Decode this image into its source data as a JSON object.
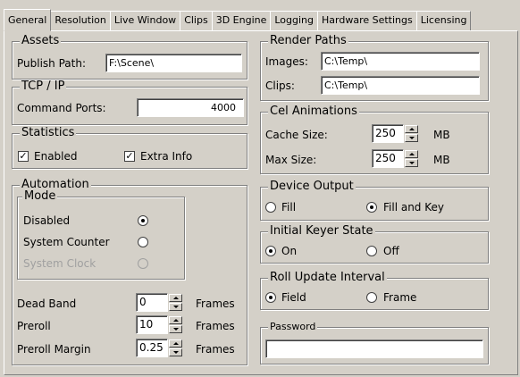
{
  "tabs": [
    "General",
    "Resolution",
    "Live Window",
    "Clips",
    "3D Engine",
    "Logging",
    "Hardware Settings",
    "Licensing"
  ],
  "assets": {
    "title": "Assets",
    "publish_label": "Publish Path:",
    "publish_value": "F:\\Scene\\"
  },
  "tcp": {
    "title": "TCP / IP",
    "ports_label": "Command Ports:",
    "ports_value": "4000"
  },
  "statistics": {
    "title": "Statistics",
    "enabled_label": "Enabled",
    "extra_label": "Extra Info",
    "enabled_checked": true,
    "extra_checked": true,
    "check_glyph": "✓"
  },
  "automation": {
    "title": "Automation",
    "mode_title": "Mode",
    "disabled_label": "Disabled",
    "system_counter_label": "System Counter",
    "system_clock_label": "System Clock",
    "selected_mode": "Disabled",
    "dead_band_label": "Dead Band",
    "dead_band_value": "0",
    "preroll_label": "Preroll",
    "preroll_value": "10",
    "preroll_margin_label": "Preroll Margin",
    "preroll_margin_value": "0.25",
    "frames_unit": "Frames"
  },
  "render_paths": {
    "title": "Render Paths",
    "images_label": "Images:",
    "images_value": "C:\\Temp\\",
    "clips_label": "Clips:",
    "clips_value": "C:\\Temp\\"
  },
  "cel_animations": {
    "title": "Cel Animations",
    "cache_label": "Cache Size:",
    "cache_value": "250",
    "max_label": "Max Size:",
    "max_value": "250",
    "unit": "MB"
  },
  "device_output": {
    "title": "Device Output",
    "fill_label": "Fill",
    "fill_key_label": "Fill and Key",
    "selected": "Fill and Key"
  },
  "keyer_state": {
    "title": "Initial Keyer State",
    "on_label": "On",
    "off_label": "Off",
    "selected": "On"
  },
  "roll_update": {
    "title": "Roll Update Interval",
    "field_label": "Field",
    "frame_label": "Frame",
    "selected": "Field"
  },
  "password": {
    "title": "Password",
    "value": ""
  }
}
